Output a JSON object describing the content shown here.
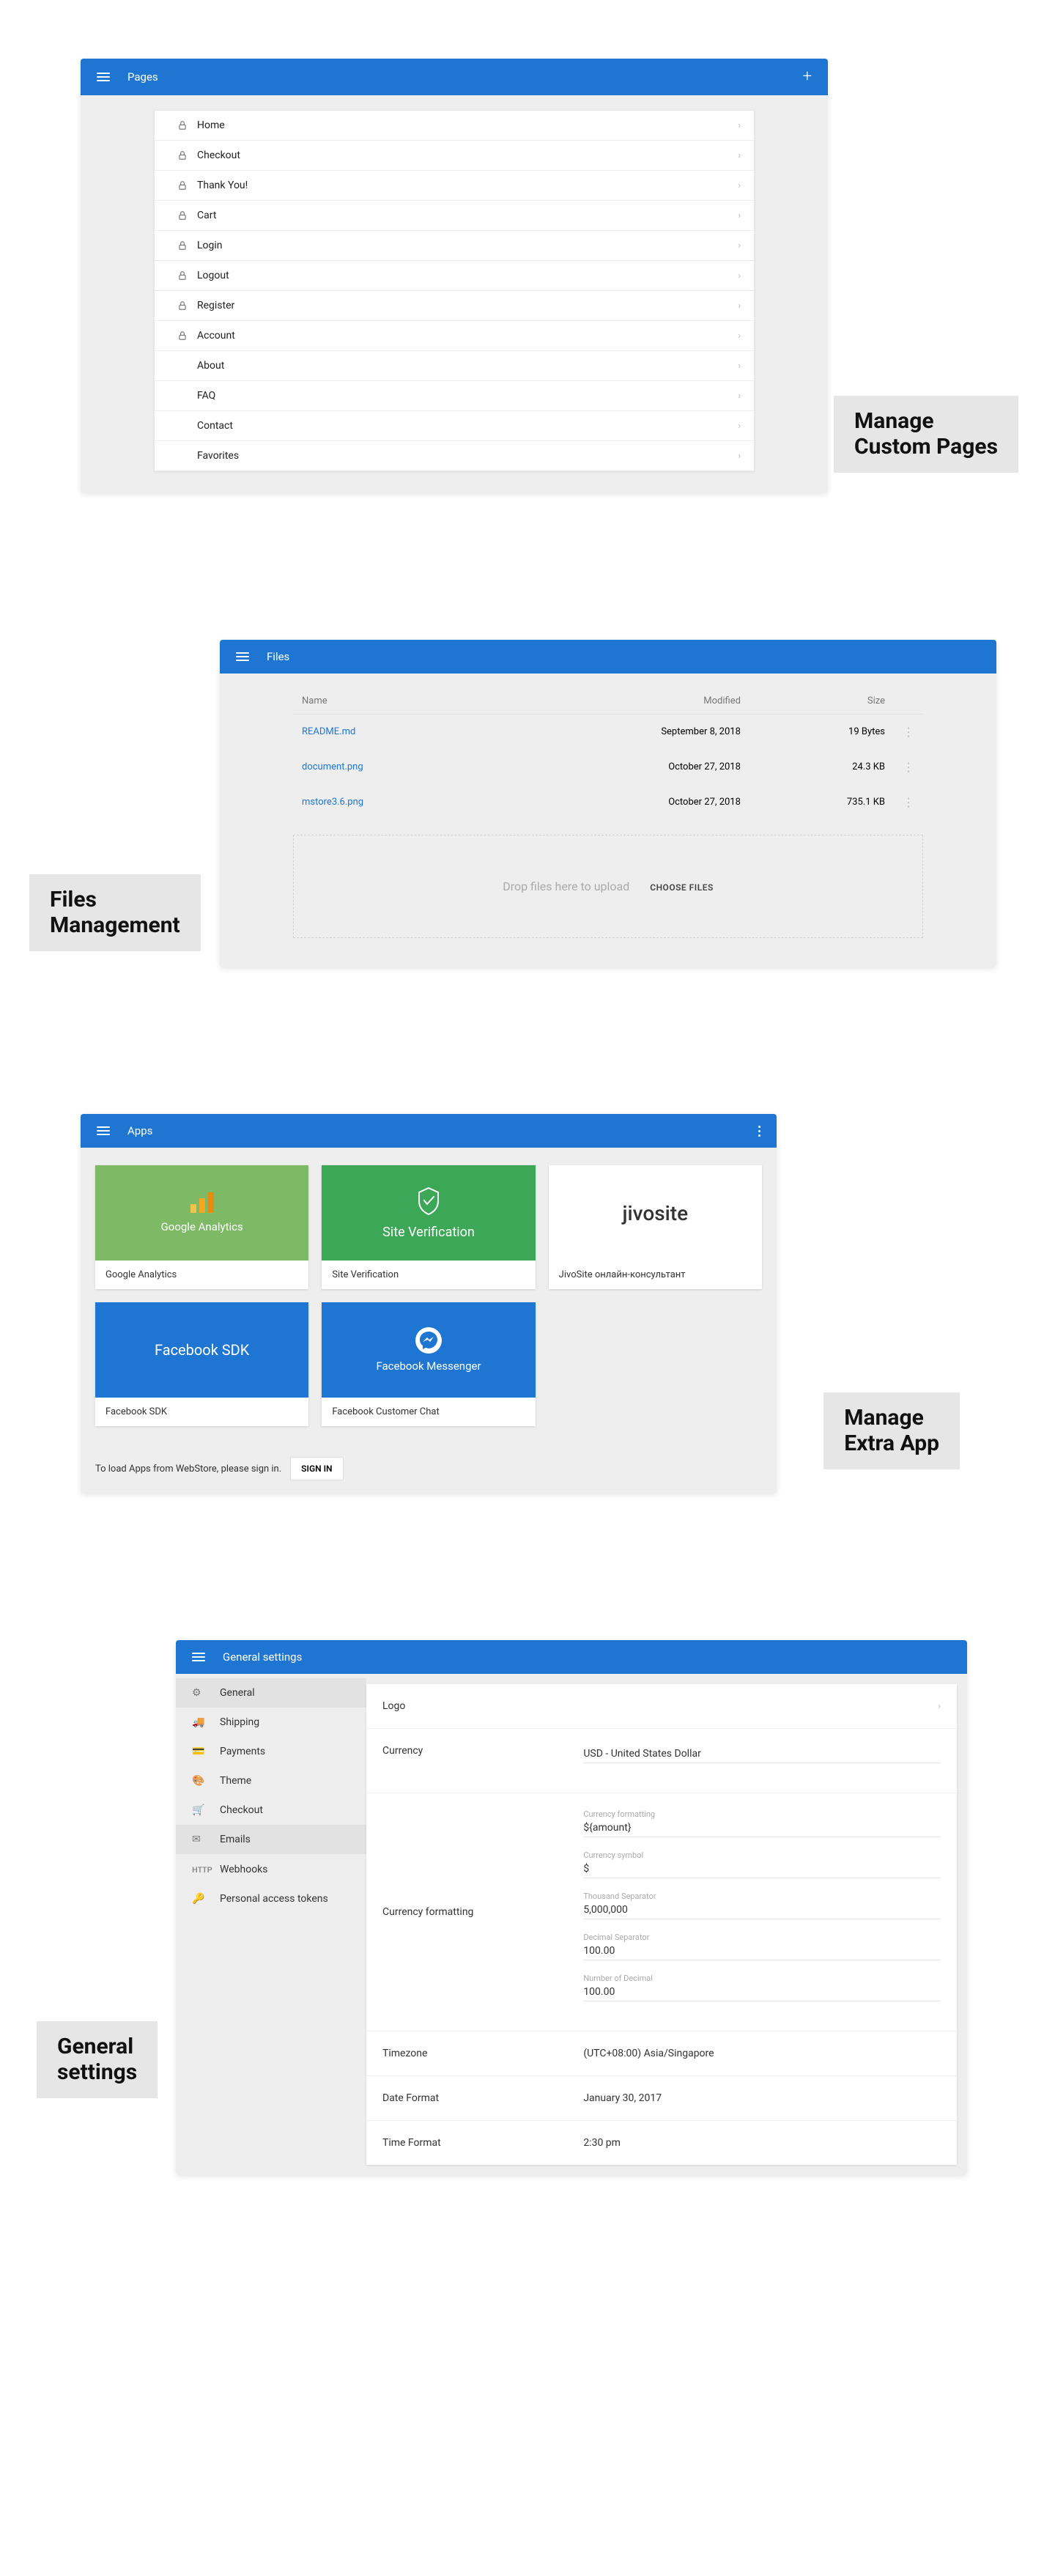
{
  "pages_panel": {
    "title": "Pages",
    "locked_items": [
      "Home",
      "Checkout",
      "Thank You!",
      "Cart",
      "Login",
      "Logout",
      "Register",
      "Account"
    ],
    "other_items": [
      "About",
      "FAQ",
      "Contact",
      "Favorites"
    ]
  },
  "badge_pages": "Manage\nCustom Pages",
  "files_panel": {
    "title": "Files",
    "cols": {
      "name": "Name",
      "modified": "Modified",
      "size": "Size"
    },
    "rows": [
      {
        "name": "README.md",
        "modified": "September 8, 2018",
        "size": "19 Bytes"
      },
      {
        "name": "document.png",
        "modified": "October 27, 2018",
        "size": "24.3 KB"
      },
      {
        "name": "mstore3.6.png",
        "modified": "October 27, 2018",
        "size": "735.1 KB"
      }
    ],
    "drop_text": "Drop files here to upload",
    "choose": "CHOOSE FILES"
  },
  "badge_files": "Files\nManagement",
  "apps_panel": {
    "title": "Apps",
    "cards": [
      {
        "head": "Google Analytics",
        "caption": "Google Analytics"
      },
      {
        "head": "Site Verification",
        "caption": "Site Verification"
      },
      {
        "head": "jivosite",
        "caption": "JivoSite онлайн-консультант"
      },
      {
        "head": "Facebook SDK",
        "caption": "Facebook SDK"
      },
      {
        "head": "Facebook Messenger",
        "caption": "Facebook Customer Chat"
      }
    ],
    "footer_text": "To load Apps from WebStore, please sign in.",
    "signin": "SIGN IN"
  },
  "badge_apps": "Manage\nExtra App",
  "settings_panel": {
    "title": "General settings",
    "nav": [
      "General",
      "Shipping",
      "Payments",
      "Theme",
      "Checkout",
      "Emails",
      "Webhooks",
      "Personal access tokens"
    ],
    "logo_label": "Logo",
    "currency_label": "Currency",
    "currency_value": "USD - United States Dollar",
    "formatting_label": "Currency formatting",
    "fields": {
      "cf_label": "Currency formatting",
      "cf_value": "${amount}",
      "cs_label": "Currency symbol",
      "cs_value": "$",
      "ts_label": "Thousand Separator",
      "ts_value": "5,000,000",
      "ds_label": "Decimal Separator",
      "ds_value": "100.00",
      "nd_label": "Number of Decimal",
      "nd_value": "100.00"
    },
    "tz_label": "Timezone",
    "tz_value": "(UTC+08:00) Asia/Singapore",
    "df_label": "Date Format",
    "df_value": "January 30, 2017",
    "tf_label": "Time Format",
    "tf_value": "2:30 pm"
  },
  "badge_settings": "General\nsettings"
}
